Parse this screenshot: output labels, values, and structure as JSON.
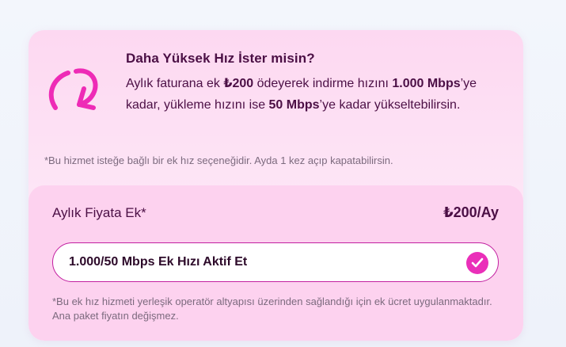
{
  "offer": {
    "title": "Daha Yüksek Hız İster misin?",
    "desc": {
      "part1": "Aylık faturana ek ",
      "price": "₺200",
      "part2": " ödeyerek indirme hızını ",
      "download": "1.000 Mbps",
      "part3": "’ye kadar, yükleme hızını ise ",
      "upload": "50 Mbps",
      "part4": "’ye kadar yükseltebilirsin."
    },
    "note": "*Bu hizmet isteğe bağlı bir ek hız seçeneğidir. Ayda 1 kez açıp kapatabilirsin.",
    "icon": "speed-arrow-icon"
  },
  "pricing": {
    "label": "Aylık Fiyata Ek*",
    "value": "₺200/Ay"
  },
  "toggle": {
    "label": "1.000/50 Mbps Ek Hızı Aktif Et",
    "checked": true,
    "icon": "checkmark-icon"
  },
  "footnote": "*Bu ek hız hizmeti yerleşik operatör altyapısı üzerinden sağlandığı için ek ücret uygulanmaktadır. Ana paket fiyatın değişmez.",
  "colors": {
    "accent": "#ea2fb9",
    "text": "#4b0f45",
    "card_bg": "#fdd8f1",
    "muted": "#7c6a7e"
  }
}
